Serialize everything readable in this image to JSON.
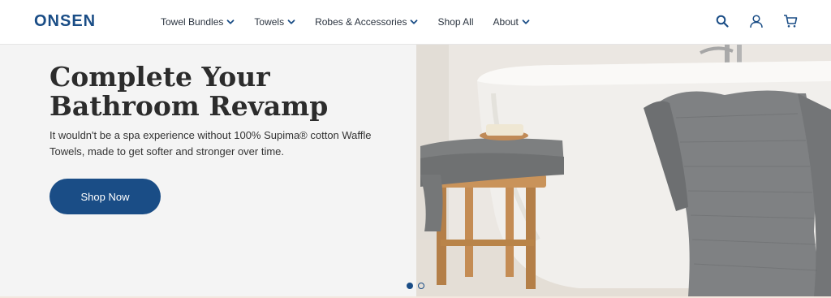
{
  "brand": {
    "logo_text": "ONSEN",
    "accent": "#1a4d86"
  },
  "nav": {
    "items": [
      {
        "label": "Towel Bundles",
        "has_dropdown": true
      },
      {
        "label": "Towels",
        "has_dropdown": true
      },
      {
        "label": "Robes & Accessories",
        "has_dropdown": true
      },
      {
        "label": "Shop All",
        "has_dropdown": false
      },
      {
        "label": "About",
        "has_dropdown": true
      }
    ]
  },
  "header_icons": [
    "search-icon",
    "account-icon",
    "cart-icon"
  ],
  "hero": {
    "title": "Complete Your Bathroom Revamp",
    "subtitle": "It wouldn't be a spa experience without 100% Supima® cotton Waffle Towels, made to get softer and stronger over time.",
    "cta_label": "Shop Now",
    "image": "bathtub-with-waffle-towels-photo"
  },
  "carousel": {
    "slides": 2,
    "active_index": 0
  }
}
